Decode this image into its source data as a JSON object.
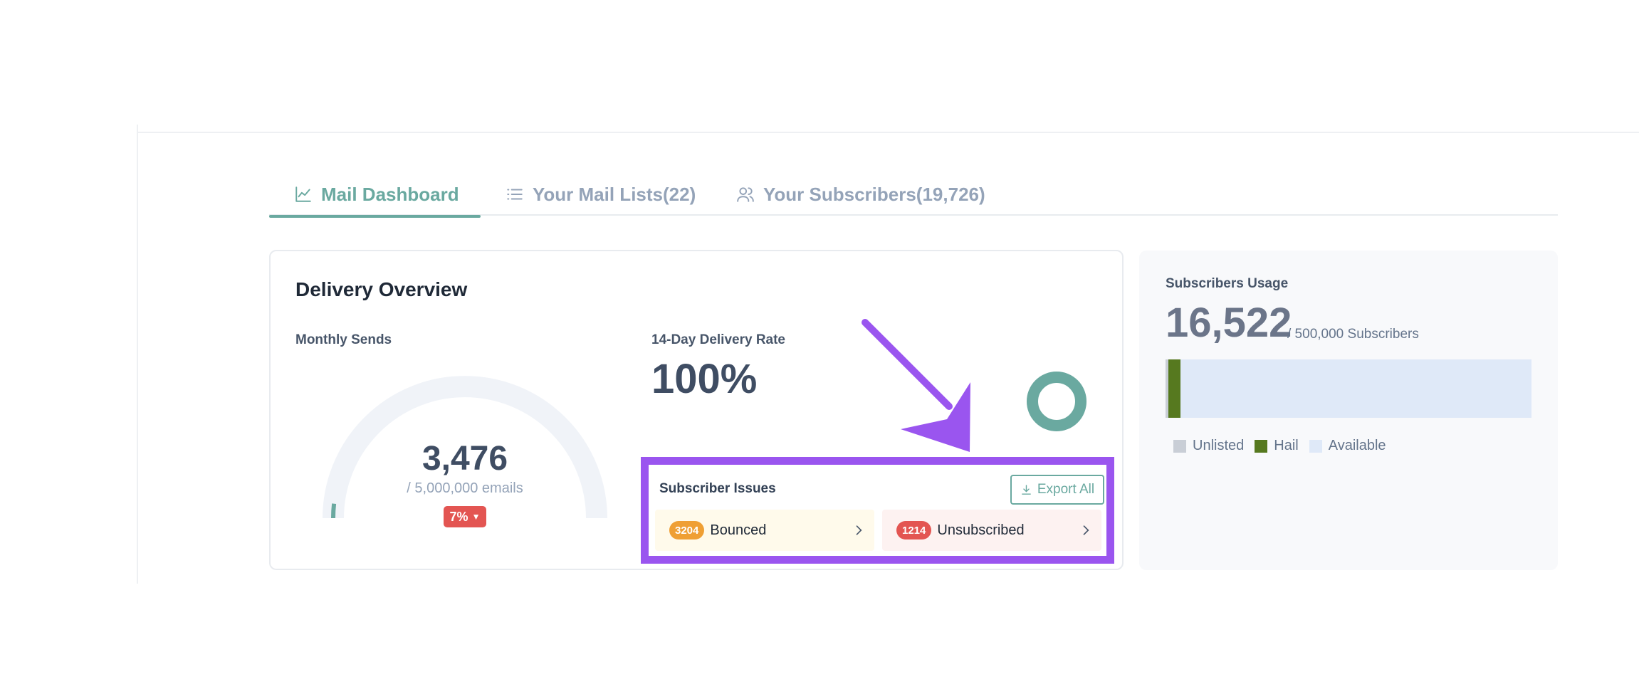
{
  "tabs": [
    {
      "label": "Mail Dashboard",
      "icon": "chart-line-icon",
      "active": true
    },
    {
      "label": "Your Mail Lists(22)",
      "icon": "list-icon",
      "active": false
    },
    {
      "label": "Your Subscribers(19,726)",
      "icon": "users-icon",
      "active": false
    }
  ],
  "delivery": {
    "title": "Delivery Overview",
    "monthly_label": "Monthly Sends",
    "sends_value": "3,476",
    "sends_limit": "/ 5,000,000 emails",
    "sends_fraction": 0.0007,
    "change_badge": "7%",
    "rate_label": "14-Day Delivery Rate",
    "rate_value": "100%",
    "rate_fraction": 1.0
  },
  "issues": {
    "title": "Subscriber Issues",
    "export_label": "Export All",
    "items": [
      {
        "count": "3204",
        "label": "Bounced"
      },
      {
        "count": "1214",
        "label": "Unsubscribed"
      }
    ]
  },
  "usage": {
    "title": "Subscribers Usage",
    "value": "16,522",
    "limit": "/ 500,000 Subscribers",
    "unlisted_fraction": 0.008,
    "hail_fraction": 0.033,
    "legend": [
      "Unlisted",
      "Hail",
      "Available"
    ]
  },
  "colors": {
    "accent": "#6aa9a0",
    "highlight": "#9a55ef",
    "danger": "#e35552",
    "warning": "#ef9f34",
    "hail": "#56791f",
    "unlisted": "#c9ced6",
    "available": "#dfe9f8"
  }
}
